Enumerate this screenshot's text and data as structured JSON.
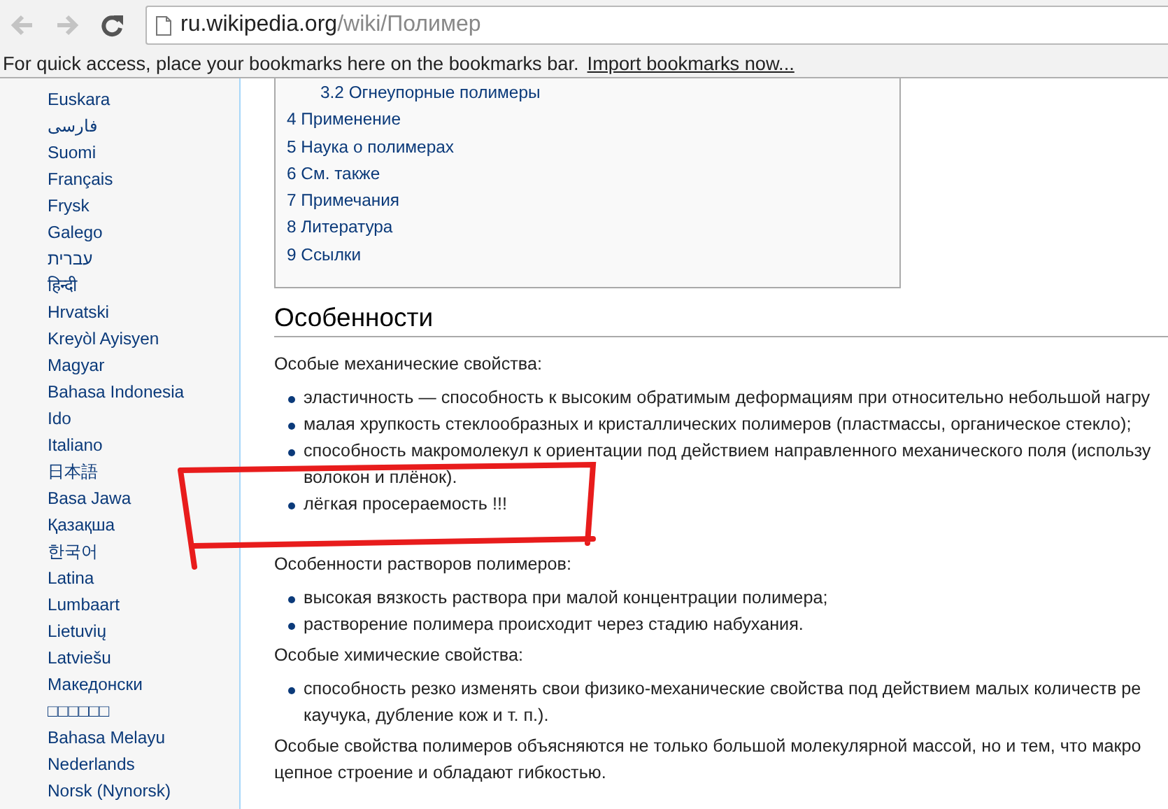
{
  "toolbar": {
    "url_host": "ru.wikipedia.org",
    "url_path": "/wiki/Полимер"
  },
  "bookmarks_bar": {
    "message": "For quick access, place your bookmarks here on the bookmarks bar.",
    "link": "Import bookmarks now..."
  },
  "sidebar": {
    "languages": [
      "Euskara",
      "فارسی",
      "Suomi",
      "Français",
      "Frysk",
      "Galego",
      "עברית",
      "हिन्दी",
      "Hrvatski",
      "Kreyòl Ayisyen",
      "Magyar",
      "Bahasa Indonesia",
      "Ido",
      "Italiano",
      "日本語",
      "Basa Jawa",
      "Қазақша",
      "한국어",
      "Latina",
      "Lumbaart",
      "Lietuvių",
      "Latviešu",
      "Македонски",
      "□□□□□□",
      "Bahasa Melayu",
      "Nederlands",
      "Norsk (Nynorsk)"
    ]
  },
  "toc": [
    {
      "kind": "subsection",
      "label": "3.2 Огнеупорные полимеры"
    },
    {
      "kind": "section",
      "label": "4 Применение"
    },
    {
      "kind": "section",
      "label": "5 Наука о полимерах"
    },
    {
      "kind": "section",
      "label": "6 См. также"
    },
    {
      "kind": "section",
      "label": "7 Примечания"
    },
    {
      "kind": "section",
      "label": "8 Литература"
    },
    {
      "kind": "section",
      "label": "9 Ссылки"
    }
  ],
  "heading": "Особенности",
  "blocks": [
    {
      "kind": "paragraph",
      "lines": [
        "Особые механические свойства:"
      ]
    },
    {
      "kind": "list",
      "items": [
        {
          "lines": [
            "эластичность — способность к высоким обратимым деформациям при относительно небольшой нагру"
          ]
        },
        {
          "lines": [
            "малая хрупкость стеклообразных и кристаллических полимеров (пластмассы, органическое стекло);"
          ]
        },
        {
          "lines": [
            "способность макромолекул к ориентации под действием направленного механического поля (использу",
            "волокон и плёнок)."
          ]
        },
        {
          "lines": [
            "лёгкая просераемость !!!"
          ]
        }
      ]
    },
    {
      "kind": "paragraph",
      "lines": [
        "Особенности растворов полимеров:"
      ]
    },
    {
      "kind": "list",
      "items": [
        {
          "lines": [
            "высокая вязкость раствора при малой концентрации полимера;"
          ]
        },
        {
          "lines": [
            "растворение полимера происходит через стадию набухания."
          ]
        }
      ]
    },
    {
      "kind": "paragraph",
      "lines": [
        "Особые химические свойства:"
      ]
    },
    {
      "kind": "list",
      "items": [
        {
          "lines": [
            "способность резко изменять свои физико-механические свойства под действием малых количеств ре",
            "каучука, дубление кож и т. п.)."
          ]
        }
      ]
    },
    {
      "kind": "paragraph",
      "lines": [
        "Особые свойства полимеров объясняются не только большой молекулярной массой, но и тем, что макро",
        "цепное строение и обладают гибкостью."
      ]
    }
  ]
}
